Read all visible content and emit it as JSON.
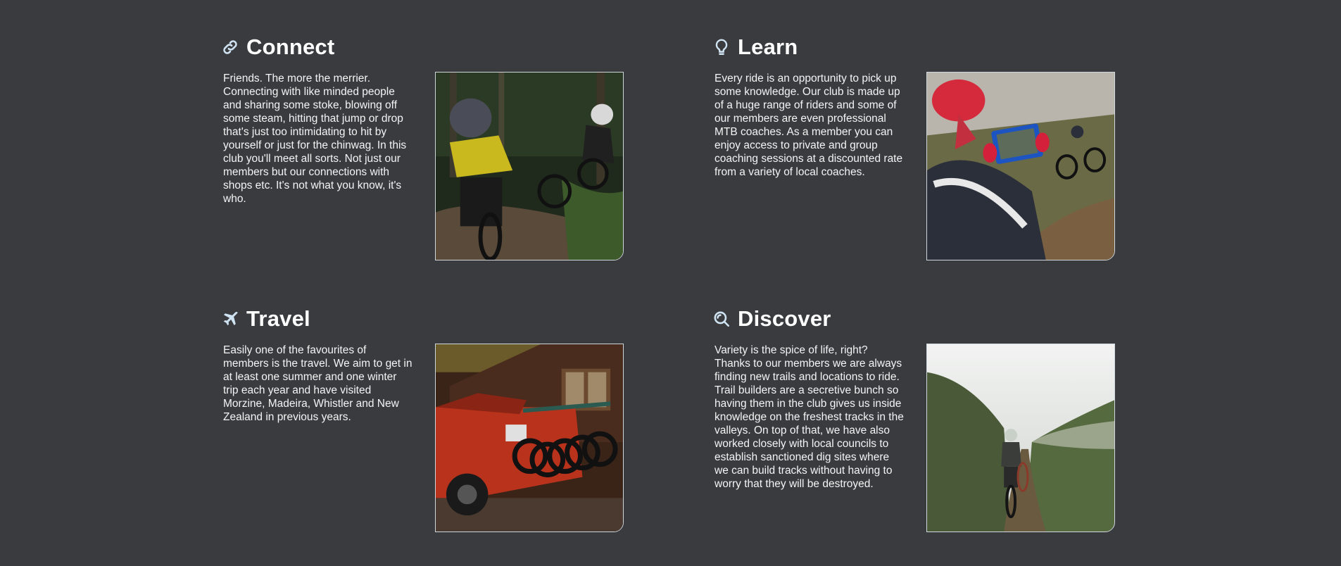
{
  "sections": [
    {
      "title": "Connect",
      "icon": "link-icon",
      "text": "Friends. The more the merrier. Connecting with like minded people and sharing some stoke, blowing off some steam, hitting that jump or drop that's just too intimidating to hit by yourself or just for the chinwag. In this club you'll meet all sorts. Not just our members but our connections with shops etc. It's not what you know, it's who.",
      "image": "mountain bikers riding forest trail"
    },
    {
      "title": "Learn",
      "icon": "lightbulb-icon",
      "text": "Every ride is an opportunity to pick up some knowledge. Our club is made up of a huge range of riders and some of our members are even professional MTB coaches. As a member you can enjoy access to private and group coaching sessions at a discounted rate from a variety of local coaches.",
      "image": "rider filming another rider with tablet"
    },
    {
      "title": "Travel",
      "icon": "plane-icon",
      "text": "Easily one of the favourites of members is the travel. We aim to get in at least one summer and one winter trip each year and have visited Morzine, Madeira, Whistler and New Zealand in previous years.",
      "image": "red pickup truck with bike rack"
    },
    {
      "title": "Discover",
      "icon": "search-icon",
      "text": "Variety is the spice of life, right? Thanks to our members we are always finding new trails and locations to ride. Trail builders are a secretive bunch so having them in the club gives us inside knowledge on the freshest tracks in the valleys. On top of that, we have also worked closely with local councils to establish sanctioned dig sites where we can build tracks without having to worry that they will be destroyed.",
      "image": "rider on misty green hillside trail"
    }
  ],
  "colors": {
    "background": "#3a3b3f",
    "icon": "#cfe3f2",
    "photo_border": "#cfd6dc"
  }
}
